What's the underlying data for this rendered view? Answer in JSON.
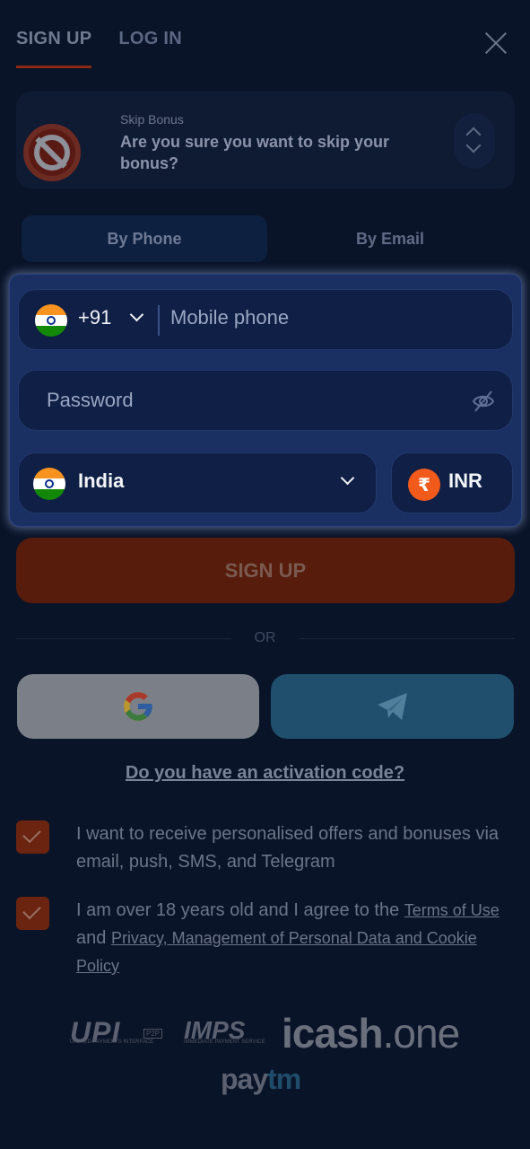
{
  "tabs": {
    "signup": "SIGN UP",
    "login": "LOG IN"
  },
  "bonus": {
    "title": "Skip Bonus",
    "text": "Are you sure you want to skip your bonus?"
  },
  "method": {
    "phone": "By Phone",
    "email": "By Email"
  },
  "form": {
    "phone_code": "+91",
    "phone_placeholder": "Mobile phone",
    "password_placeholder": "Password",
    "country": "India",
    "currency_symbol": "₹",
    "currency": "INR"
  },
  "signup_button": "SIGN UP",
  "or_text": "OR",
  "activation_link": "Do you have an activation code?",
  "consents": {
    "offers": "I want to receive personalised offers and bonuses via email, push, SMS, and Telegram",
    "age_prefix": "I am over 18 years old and I agree to the",
    "terms_link": "Terms of Use",
    "and": "and",
    "privacy_link": "Privacy, Management of Personal Data and Cookie Policy"
  },
  "payment_logos": {
    "upi": "UPI",
    "upi_sub": "UNIFIED PAYMENTS INTERFACE",
    "p2p": "P2P",
    "imps": "IMPS",
    "imps_sub": "IMMEDIATE PAYMENT SERVICE",
    "icash_main": "icash",
    "icash_suffix": ".one",
    "paytm_pay": "pay",
    "paytm_tm": "tm"
  },
  "colors": {
    "accent": "#8a2a12",
    "panel": "#1b3062",
    "signup_bg": "#571c0b"
  }
}
